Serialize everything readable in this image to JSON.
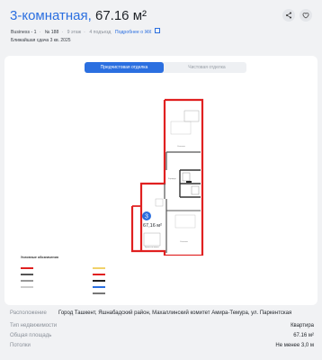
{
  "header": {
    "rooms": "3-комнатная,",
    "area": "67.16 м²",
    "meta": {
      "project": "Business - 1",
      "number": "№ 188",
      "floor": "9 этаж",
      "entrance": "4 подъезд",
      "details_link": "Подробнее о ЖК"
    },
    "delivery": "Ближайшая сдача 3 кв. 2025"
  },
  "tabs": {
    "active": "Предчистовая отделка",
    "inactive": "Чистовая отделка"
  },
  "plan": {
    "room_number": "3",
    "area_label": "67,16 м²"
  },
  "legend": {
    "title": "Условные обозначения"
  },
  "details": [
    {
      "key": "Расположение",
      "value": "Город Ташкент, Яшнабадский район, Махаллинский комитет Амира-Темура, ул. Паркентская"
    },
    {
      "key": "Тип недвижимости",
      "value": "Квартира"
    },
    {
      "key": "Общая площадь",
      "value": "67.16 м²"
    },
    {
      "key": "Потолки",
      "value": "Не менее 3,0 м"
    }
  ],
  "icons": {
    "share": "share-icon",
    "favorite": "heart-icon",
    "external": "external-link-icon"
  },
  "colors": {
    "accent": "#2b6fe0",
    "wall": "#e02020",
    "interior_wall": "#555555",
    "room_badge": "#2b6fe0"
  }
}
